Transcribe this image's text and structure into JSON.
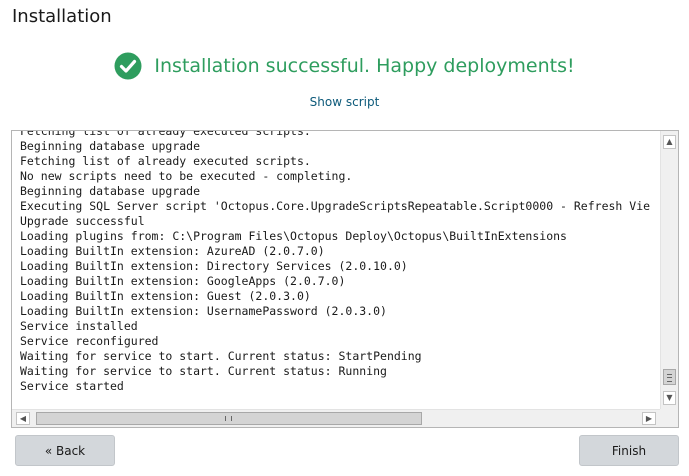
{
  "window": {
    "title": "Installation"
  },
  "status": {
    "icon": "check-circle-icon",
    "message": "Installation successful. Happy deployments!",
    "color": "#2e9d5e"
  },
  "show_script": {
    "label": "Show script"
  },
  "log": {
    "lines": [
      "Fetching list of already executed scripts.",
      "Beginning database upgrade",
      "Fetching list of already executed scripts.",
      "No new scripts need to be executed - completing.",
      "Beginning database upgrade",
      "Executing SQL Server script 'Octopus.Core.UpgradeScriptsRepeatable.Script0000 - Refresh Vie",
      "Upgrade successful",
      "Loading plugins from: C:\\Program Files\\Octopus Deploy\\Octopus\\BuiltInExtensions",
      "Loading BuiltIn extension: AzureAD (2.0.7.0)",
      "Loading BuiltIn extension: Directory Services (2.0.10.0)",
      "Loading BuiltIn extension: GoogleApps (2.0.7.0)",
      "Loading BuiltIn extension: Guest (2.0.3.0)",
      "Loading BuiltIn extension: UsernamePassword (2.0.3.0)",
      "Service installed",
      "Service reconfigured",
      "Waiting for service to start. Current status: StartPending",
      "Waiting for service to start. Current status: Running",
      "Service started"
    ]
  },
  "buttons": {
    "back_label": "« Back",
    "finish_label": "Finish"
  }
}
